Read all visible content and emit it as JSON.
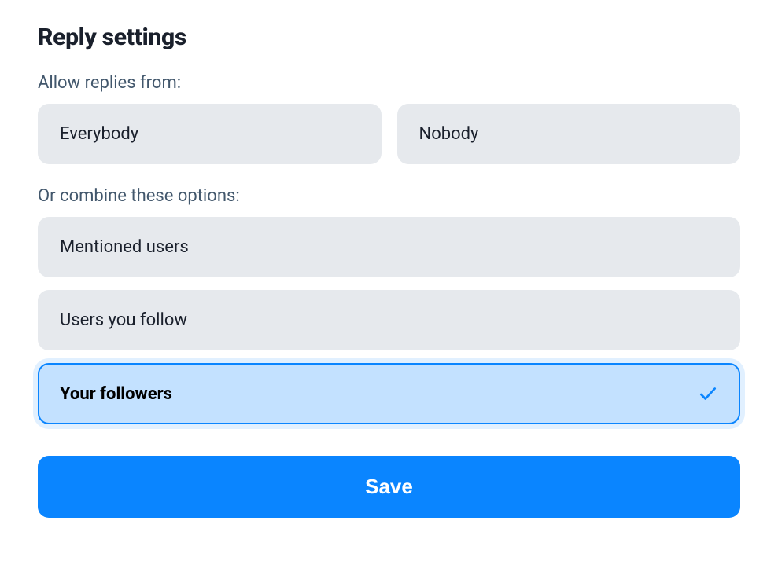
{
  "heading": "Reply settings",
  "allowLabel": "Allow replies from:",
  "combineLabel": "Or combine these options:",
  "primaryOptions": [
    {
      "label": "Everybody",
      "selected": false
    },
    {
      "label": "Nobody",
      "selected": false
    }
  ],
  "combineOptions": [
    {
      "label": "Mentioned users",
      "selected": false
    },
    {
      "label": "Users you follow",
      "selected": false
    },
    {
      "label": "Your followers",
      "selected": true
    }
  ],
  "saveLabel": "Save"
}
